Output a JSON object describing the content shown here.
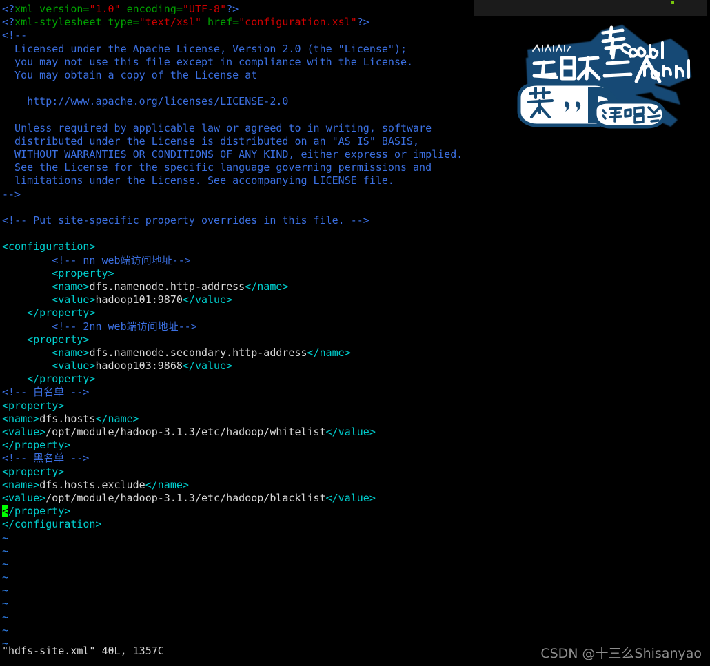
{
  "editor": {
    "filename": "hdfs-site.xml",
    "statusline": "\"hdfs-site.xml\" 40L, 1357C",
    "lines_count": "40L",
    "chars_count": "1357C",
    "empty_line_marker": "~",
    "empty_line_rows": 9,
    "cursor_char": "<"
  },
  "watermark": {
    "text": "CSDN @十三么Shisanyao"
  },
  "logo": {
    "alt": "concert-logo",
    "badge_text_cn": "英",
    "badge_text_dots": ",,",
    "badge_text_d": "D",
    "subtitle_cn": "演唱会",
    "headline_cn": "五月天  二人生",
    "headline_en_1": "Second",
    "headline_en_2": "round",
    "color_navy": "#164a74",
    "color_white": "#ffffff"
  },
  "colors": {
    "background": "#000000",
    "tag": "#00cdcd",
    "attr": "#00a000",
    "string": "#cd0000",
    "comment": "#3b6fe0",
    "text": "#d8d8d8",
    "tilde": "#2f7fe8",
    "cursor": "#00ff00",
    "topbar": "#1b1b1b",
    "watermark": "#8e8e8e"
  },
  "file": {
    "lines": [
      {
        "t": "pi",
        "punct_open": "<?",
        "name": "xml",
        "attrs": [
          {
            "k": " version=",
            "v": "\"1.0\""
          },
          {
            "k": " encoding=",
            "v": "\"UTF-8\""
          }
        ],
        "punct_close": "?>"
      },
      {
        "t": "pi",
        "punct_open": "<?",
        "name": "xml-stylesheet",
        "attrs": [
          {
            "k": " type=",
            "v": "\"text/xsl\""
          },
          {
            "k": " href=",
            "v": "\"configuration.xsl\""
          }
        ],
        "punct_close": "?>"
      },
      {
        "t": "comment",
        "text": "<!--"
      },
      {
        "t": "comment",
        "text": "  Licensed under the Apache License, Version 2.0 (the \"License\");"
      },
      {
        "t": "comment",
        "text": "  you may not use this file except in compliance with the License."
      },
      {
        "t": "comment",
        "text": "  You may obtain a copy of the License at"
      },
      {
        "t": "blank",
        "text": ""
      },
      {
        "t": "comment",
        "text": "    http://www.apache.org/licenses/LICENSE-2.0"
      },
      {
        "t": "blank",
        "text": ""
      },
      {
        "t": "comment",
        "text": "  Unless required by applicable law or agreed to in writing, software"
      },
      {
        "t": "comment",
        "text": "  distributed under the License is distributed on an \"AS IS\" BASIS,"
      },
      {
        "t": "comment",
        "text": "  WITHOUT WARRANTIES OR CONDITIONS OF ANY KIND, either express or implied."
      },
      {
        "t": "comment",
        "text": "  See the License for the specific language governing permissions and"
      },
      {
        "t": "comment",
        "text": "  limitations under the License. See accompanying LICENSE file."
      },
      {
        "t": "comment",
        "text": "-->"
      },
      {
        "t": "blank",
        "text": ""
      },
      {
        "t": "comment",
        "text": "<!-- Put site-specific property overrides in this file. -->"
      },
      {
        "t": "blank",
        "text": ""
      },
      {
        "t": "tagonly",
        "indent": "",
        "tag": "<configuration>"
      },
      {
        "t": "comment",
        "text": "        <!-- nn web端访问地址-->"
      },
      {
        "t": "tagonly",
        "indent": "        ",
        "tag": "<property>"
      },
      {
        "t": "elem",
        "indent": "        ",
        "open": "<name>",
        "value": "dfs.namenode.http-address",
        "close": "</name>"
      },
      {
        "t": "elem",
        "indent": "        ",
        "open": "<value>",
        "value": "hadoop101:9870",
        "close": "</value>"
      },
      {
        "t": "tagonly",
        "indent": "    ",
        "tag": "</property>"
      },
      {
        "t": "comment",
        "text": "        <!-- 2nn web端访问地址-->"
      },
      {
        "t": "tagonly",
        "indent": "    ",
        "tag": "<property>"
      },
      {
        "t": "elem",
        "indent": "        ",
        "open": "<name>",
        "value": "dfs.namenode.secondary.http-address",
        "close": "</name>"
      },
      {
        "t": "elem",
        "indent": "        ",
        "open": "<value>",
        "value": "hadoop103:9868",
        "close": "</value>"
      },
      {
        "t": "tagonly",
        "indent": "    ",
        "tag": "</property>"
      },
      {
        "t": "comment",
        "text": "<!-- 白名单 -->"
      },
      {
        "t": "tagonly",
        "indent": "",
        "tag": "<property>"
      },
      {
        "t": "elem",
        "indent": "",
        "open": "<name>",
        "value": "dfs.hosts",
        "close": "</name>"
      },
      {
        "t": "elem",
        "indent": "",
        "open": "<value>",
        "value": "/opt/module/hadoop-3.1.3/etc/hadoop/whitelist",
        "close": "</value>"
      },
      {
        "t": "tagonly",
        "indent": "",
        "tag": "</property>"
      },
      {
        "t": "comment",
        "text": "<!-- 黑名单 -->"
      },
      {
        "t": "tagonly",
        "indent": "",
        "tag": "<property>"
      },
      {
        "t": "elem",
        "indent": "",
        "open": "<name>",
        "value": "dfs.hosts.exclude",
        "close": "</name>"
      },
      {
        "t": "elem",
        "indent": "",
        "open": "<value>",
        "value": "/opt/module/hadoop-3.1.3/etc/hadoop/blacklist",
        "close": "</value>"
      },
      {
        "t": "cursorline",
        "indent": "",
        "cursor": "<",
        "rest": "/property>"
      },
      {
        "t": "tagonly",
        "indent": "",
        "tag": "</configuration>"
      }
    ]
  }
}
